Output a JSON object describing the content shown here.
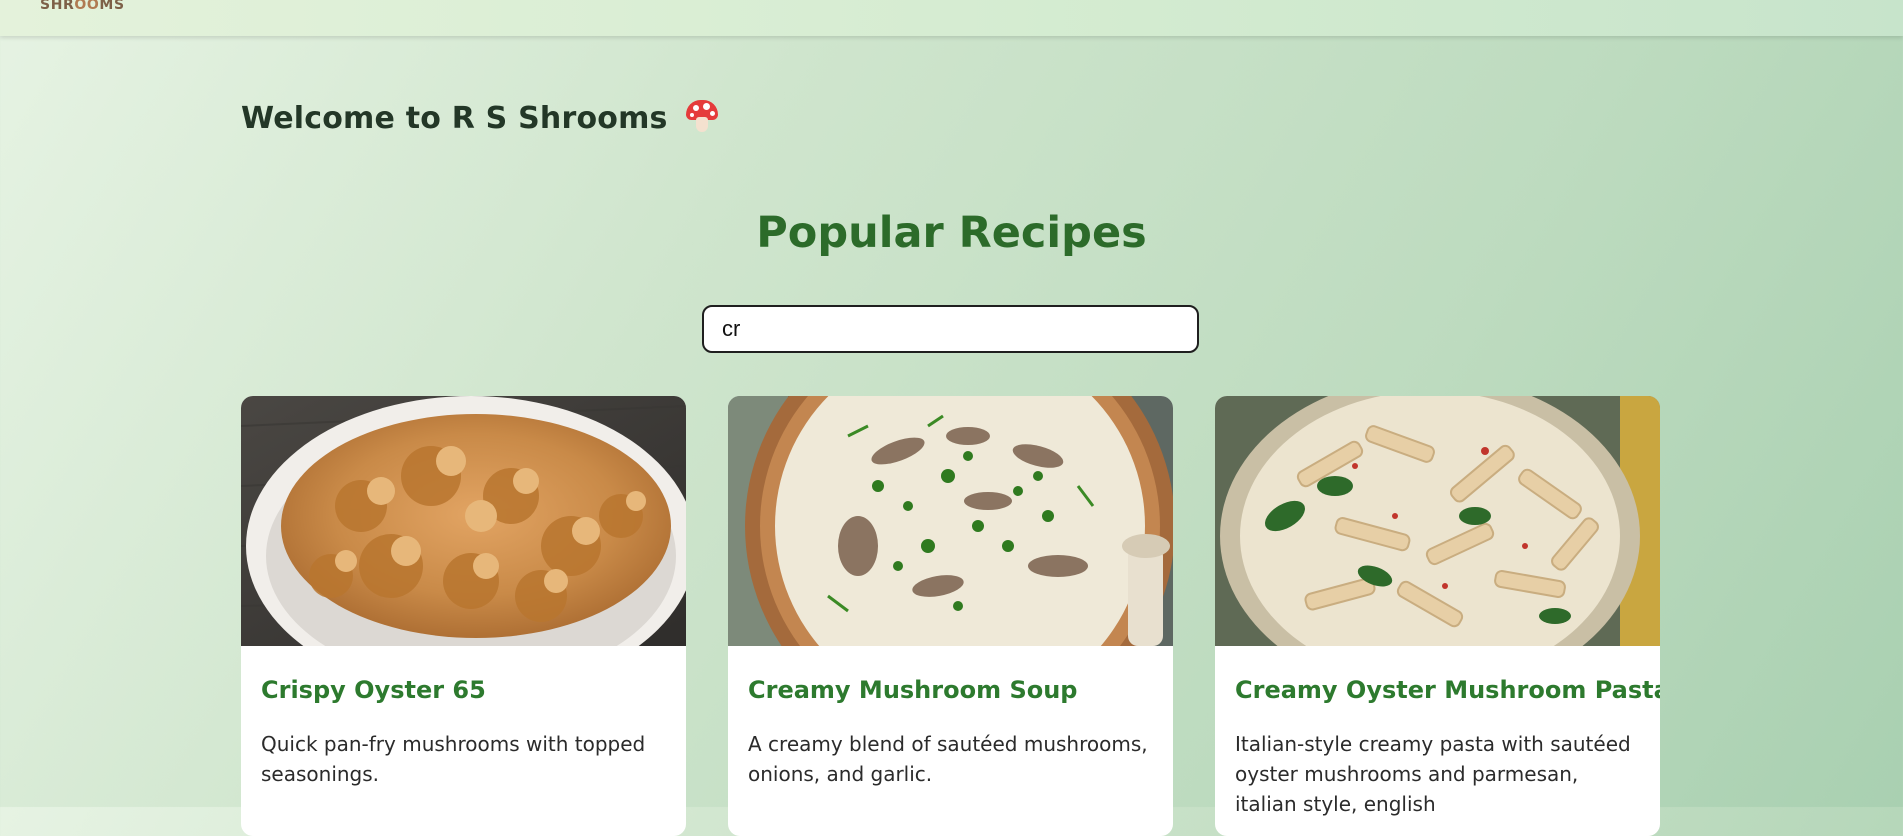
{
  "brand": {
    "logo_text_a": "S",
    "logo_text_b": "HR",
    "logo_text_c": "OO",
    "logo_text_d": "MS"
  },
  "header": {
    "welcome": "Welcome to R S Shrooms",
    "welcome_icon": "mushroom-icon"
  },
  "recipes": {
    "section_title": "Popular Recipes",
    "search": {
      "value": "cr",
      "placeholder": ""
    },
    "cards": [
      {
        "title": "Crispy Oyster 65",
        "description": "Quick pan-fry mushrooms with topped seasonings.",
        "image": "crispy-oyster-photo"
      },
      {
        "title": "Creamy Mushroom Soup",
        "description": "A creamy blend of sautéed mushrooms, onions, and garlic.",
        "image": "mushroom-soup-photo"
      },
      {
        "title": "Creamy Oyster Mushroom Pasta",
        "description": "Italian-style creamy pasta with sautéed oyster mushrooms and parmesan, italian style, english",
        "image": "mushroom-pasta-photo"
      }
    ]
  },
  "colors": {
    "accent": "#2d7a2e",
    "title": "#2c6b2a",
    "text": "#233727"
  }
}
